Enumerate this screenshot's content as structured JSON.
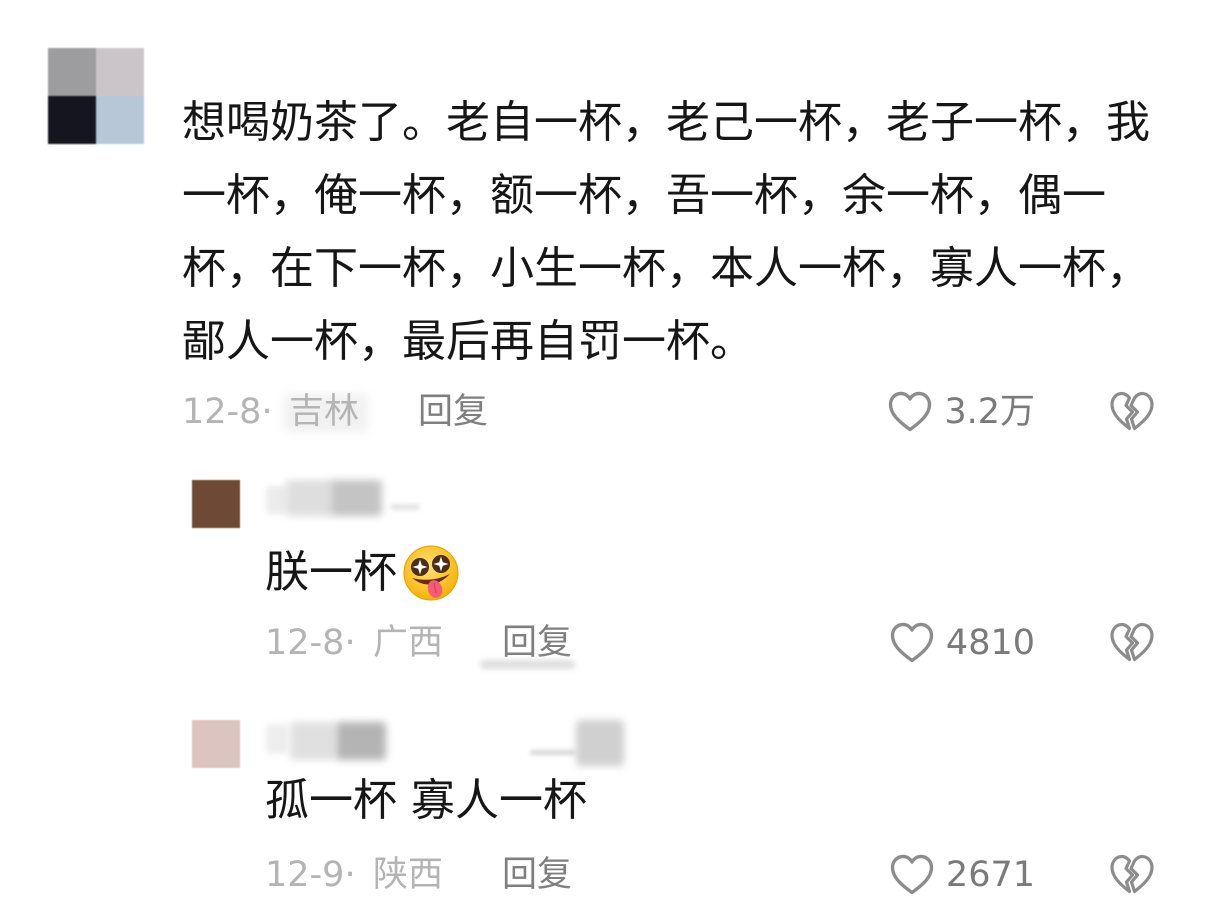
{
  "colors": {
    "text": "#161616",
    "meta": "#b4b4b4",
    "reply": "#7f7f7f",
    "count": "#7a7a7a",
    "icon": "#8c8c8c"
  },
  "icons": {
    "like": "heart-outline-icon",
    "dislike": "broken-heart-icon",
    "emoji": "star-eyes-tongue-emoji"
  },
  "separator": "·",
  "comment": {
    "avatar_colors": [
      "#9d9d9f",
      "#cbc5c9",
      "#15151f",
      "#b8c7d8"
    ],
    "text": "想喝奶茶了。老自一杯，老己一杯，老子一杯，我一杯，俺一杯，额一杯，吾一杯，余一杯，偶一杯，在下一杯，小生一杯，本人一杯，寡人一杯，鄙人一杯，最后再自罚一杯。",
    "date": "12-8",
    "location": "吉林",
    "reply_label": "回复",
    "likes": "3.2万"
  },
  "replies": [
    {
      "avatar_color": "#6e4a36",
      "text": "朕一杯",
      "emoji": "star-eyes-tongue-emoji",
      "date": "12-8",
      "location": "广西",
      "reply_label": "回复",
      "likes": "4810"
    },
    {
      "avatar_color": "#dcc4c1",
      "text": "孤一杯 寡人一杯",
      "date": "12-9",
      "location": "陕西",
      "reply_label": "回复",
      "likes": "2671"
    }
  ]
}
